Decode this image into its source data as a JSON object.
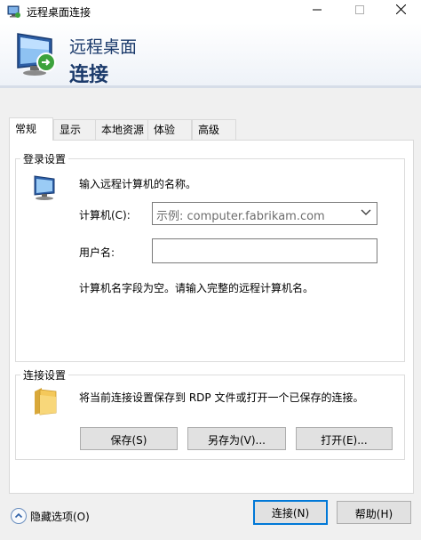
{
  "window": {
    "title": "远程桌面连接"
  },
  "banner": {
    "line1": "远程桌面",
    "line2": "连接"
  },
  "tabs": [
    "常规",
    "显示",
    "本地资源",
    "体验",
    "高级"
  ],
  "login": {
    "group_label": "登录设置",
    "instruction": "输入远程计算机的名称。",
    "computer_label": "计算机(C):",
    "computer_placeholder": "示例: computer.fabrikam.com",
    "username_label": "用户名:",
    "username_value": "",
    "error_text": "计算机名字段为空。请输入完整的远程计算机名。"
  },
  "connection": {
    "group_label": "连接设置",
    "description": "将当前连接设置保存到 RDP 文件或打开一个已保存的连接。",
    "save_label": "保存(S)",
    "save_as_label": "另存为(V)...",
    "open_label": "打开(E)..."
  },
  "footer": {
    "hide_options_label": "隐藏选项(O)",
    "connect_label": "连接(N)",
    "help_label": "帮助(H)"
  },
  "icons": [
    "remote-desktop-icon",
    "minimize-icon",
    "maximize-icon",
    "close-icon",
    "computer-icon",
    "folder-icon",
    "chevron-down-icon",
    "collapse-arrow-icon"
  ],
  "colors": {
    "accent": "#0078d7",
    "banner_text": "#1b3a6b"
  }
}
